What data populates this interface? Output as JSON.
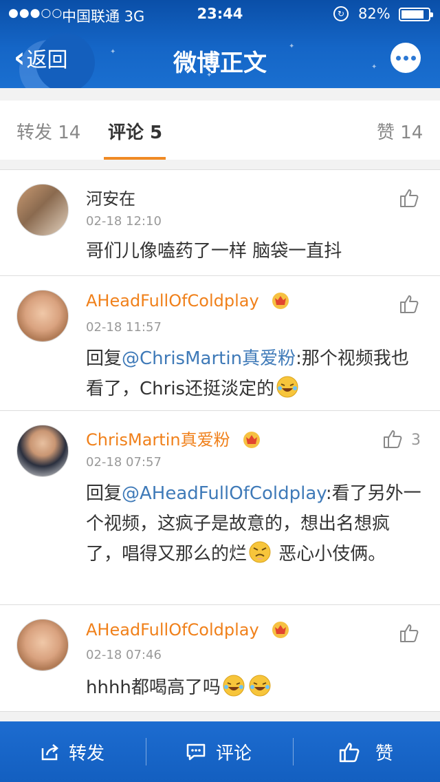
{
  "status_bar": {
    "signal": "●●●○○",
    "carrier": "中国联通  3G",
    "time": "23:44",
    "battery": "82%"
  },
  "nav": {
    "back_label": "返回",
    "title": "微博正文"
  },
  "tabs": {
    "repost": "转发 14",
    "comment": "评论 5",
    "like": "赞 14"
  },
  "comments": [
    {
      "username": "河安在",
      "time": "02-18 12:10",
      "text": "哥们儿像嗑药了一样 脑袋一直抖",
      "likes": ""
    },
    {
      "username": "AHeadFullOfColdplay",
      "time": "02-18 11:57",
      "reply_prefix": "回复",
      "mention": "@ChrisMartin真爱粉",
      "text": ":那个视频我也看了，Chris还挺淡定的",
      "likes": ""
    },
    {
      "username": "ChrisMartin真爱粉",
      "time": "02-18 07:57",
      "reply_prefix": "回复",
      "mention": "@AHeadFullOfColdplay",
      "text": ":看了另外一个视频，这疯子是故意的，想出名想疯了，唱得又那么的烂",
      "text_after": " 恶心小伎俩。",
      "likes": "3"
    },
    {
      "username": "AHeadFullOfColdplay",
      "time": "02-18 07:46",
      "text": "hhhh都喝高了吗",
      "likes": ""
    }
  ],
  "bottom_bar": {
    "repost": "转发",
    "comment": "评论",
    "like": "赞"
  },
  "colors": {
    "header_blue": "#1566c7",
    "username_orange": "#f0801a",
    "mention_blue": "#3f7ab8",
    "tab_underline": "#f08a24"
  }
}
